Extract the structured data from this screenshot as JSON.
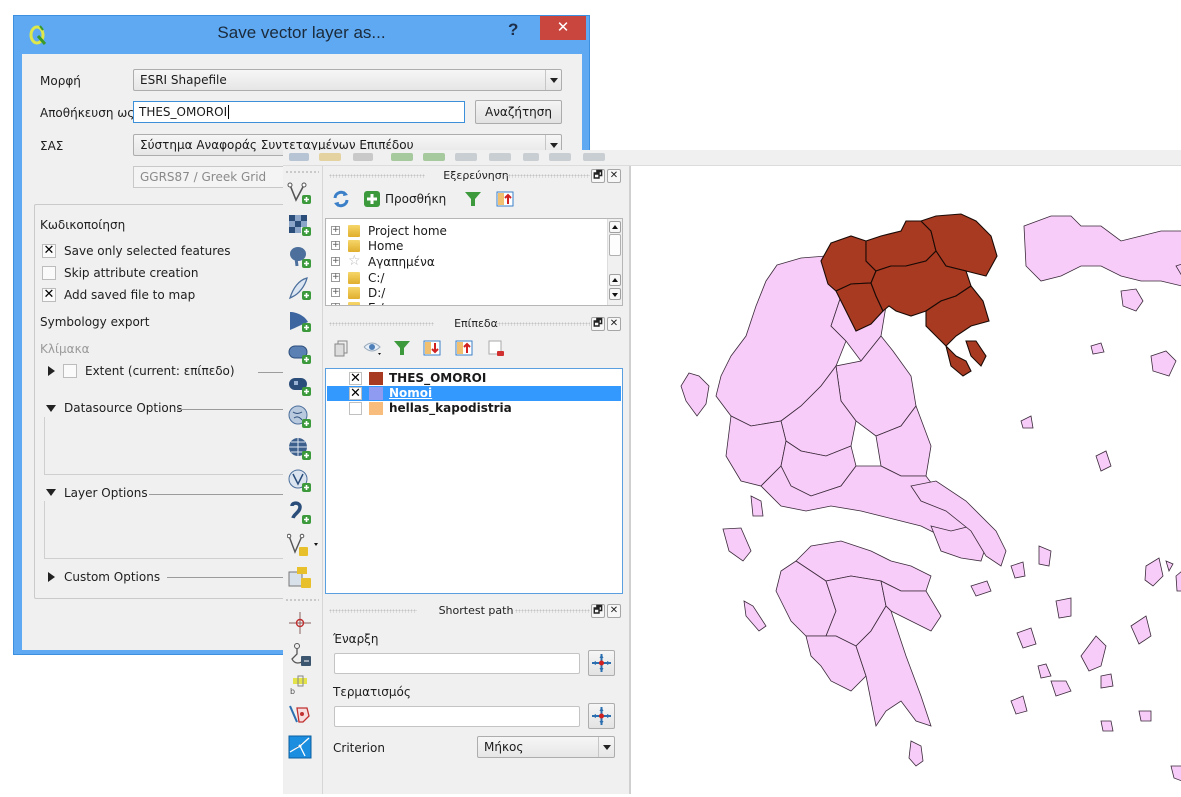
{
  "dialog": {
    "title": "Save vector layer as...",
    "help_label": "?",
    "close_label": "✕",
    "format_label": "Μορφή",
    "format_value": "ESRI Shapefile",
    "save_as_label": "Αποθήκευση ως",
    "save_as_value": "THES_OMOROI",
    "browse_label": "Αναζήτηση",
    "crs_label": "ΣΑΣ",
    "crs_value": "Σύστημα Αναφοράς Συντεταγμένων Επιπέδου",
    "crs_detail": "GGRS87 / Greek Grid",
    "encoding_label": "Κωδικοποίηση",
    "options": [
      {
        "label": "Save only selected features",
        "checked": true,
        "mark": "✕"
      },
      {
        "label": "Skip attribute creation",
        "checked": false,
        "mark": ""
      },
      {
        "label": "Add saved file to map",
        "checked": true,
        "mark": "✕"
      }
    ],
    "symbology_label": "Symbology export",
    "scale_label": "Κλίμακα",
    "extent_label": "Extent (current: επίπεδο)",
    "datasource_label": "Datasource Options",
    "layer_options_label": "Layer Options",
    "custom_options_label": "Custom Options"
  },
  "browser_panel": {
    "title": "Εξερεύνηση",
    "add_label": "Προσθήκη",
    "items": [
      {
        "label": "Project home",
        "icon": "folder-icon"
      },
      {
        "label": "Home",
        "icon": "home-folder-icon"
      },
      {
        "label": "Αγαπημένα",
        "icon": "favourites-star-icon"
      },
      {
        "label": "C:/",
        "icon": "drive-folder-icon"
      },
      {
        "label": "D:/",
        "icon": "drive-folder-icon"
      },
      {
        "label": "E:/",
        "icon": "drive-folder-icon"
      }
    ]
  },
  "layers_panel": {
    "title": "Επίπεδα",
    "layers": [
      {
        "name": "THES_OMOROI",
        "visible": true,
        "mark": "✕",
        "color": "#a83a22",
        "selected": false
      },
      {
        "name": "Nomoi",
        "visible": true,
        "mark": "✕",
        "color": "#8e9bf0",
        "selected": true
      },
      {
        "name": "hellas_kapodistria",
        "visible": false,
        "mark": "",
        "color": "#f8bd7c",
        "selected": false
      }
    ]
  },
  "shortest_path_panel": {
    "title": "Shortest path",
    "start_label": "Έναρξη",
    "start_value": "",
    "end_label": "Τερματισμός",
    "end_value": "",
    "criterion_label": "Criterion",
    "criterion_value": "Μήκος"
  },
  "panel_buttons": {
    "float": "🗗",
    "close": "✕"
  },
  "map": {
    "selected_fill": "#a83a22",
    "base_fill": "#f8ccf8",
    "outline": "#3a2a3a"
  }
}
